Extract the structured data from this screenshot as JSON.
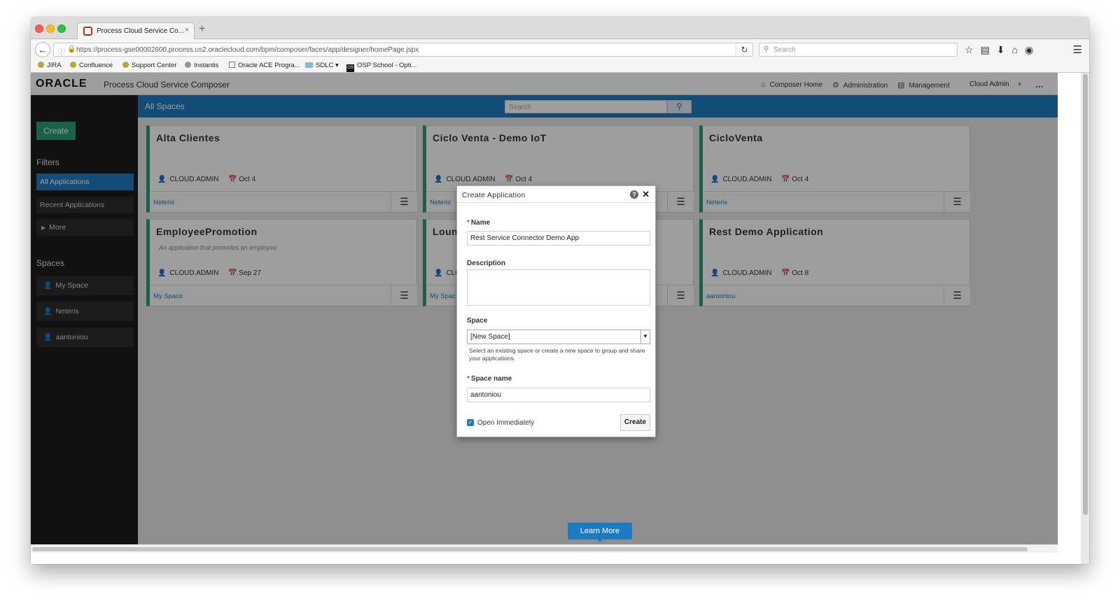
{
  "browser": {
    "tab_title": "Process Cloud Service Co...",
    "tab_close": "×",
    "new_tab": "+",
    "url": "https://process-gse00002600.process.us2.oraclecloud.com/bpm/composer/faces/app/designer/homePage.jspx",
    "search_placeholder": "Search",
    "bookmarks": [
      "JIRA",
      "Confluence",
      "Support Center",
      "Instantis",
      "Oracle ACE Progra...",
      "SDLC",
      "OSP School - Opti..."
    ]
  },
  "app": {
    "logo": "ORACLE",
    "title": "Process Cloud Service Composer",
    "nav": {
      "composer_home": "Composer Home",
      "administration": "Administration",
      "management": "Management",
      "user": "Cloud Admin"
    },
    "more": "..."
  },
  "sidebar": {
    "create": "Create",
    "filters_heading": "Filters",
    "filters": [
      "All Applications",
      "Recent Applications",
      "More"
    ],
    "spaces_heading": "Spaces",
    "spaces": [
      "My Space",
      "Neteris",
      "aantoniou"
    ]
  },
  "main": {
    "bar_label": "All Spaces",
    "search_placeholder": "Search",
    "learn_more": "Learn More",
    "cards": [
      {
        "title": "Alta Clientes",
        "description": "",
        "owner": "CLOUD.ADMIN",
        "date": "Oct 4",
        "space": "Neteris"
      },
      {
        "title": "Ciclo Venta - Demo IoT",
        "description": "",
        "owner": "CLOUD.ADMIN",
        "date": "Oct 4",
        "space": "Neteris"
      },
      {
        "title": "CicloVenta",
        "description": "",
        "owner": "CLOUD.ADMIN",
        "date": "Oct 4",
        "space": "Neteris"
      },
      {
        "title": "EmployeePromotion",
        "description": "An application that promotes an employee",
        "owner": "CLOUD.ADMIN",
        "date": "Sep 27",
        "space": "My Space"
      },
      {
        "title": "Loun",
        "description": "",
        "owner": "CLO",
        "date": "",
        "space": "My Spac"
      },
      {
        "title": "Rest Demo Application",
        "description": "",
        "owner": "CLOUD.ADMIN",
        "date": "Oct 8",
        "space": "aantoniou"
      }
    ]
  },
  "dialog": {
    "title": "Create Application",
    "name_label": "Name",
    "name_value": "Rest Service Connector Demo App",
    "description_label": "Description",
    "space_label": "Space",
    "space_value": "[New Space]",
    "space_help": "Select an existing space or create a new space to group and share your applications.",
    "space_name_label": "Space name",
    "space_name_value": "aantoniou",
    "open_immediately": "Open Immediately",
    "create": "Create"
  },
  "colors": {
    "brand_blue": "#1f7bc1",
    "accent_green": "#2a9d76",
    "sidebar_bg": "#1c1c1c"
  }
}
